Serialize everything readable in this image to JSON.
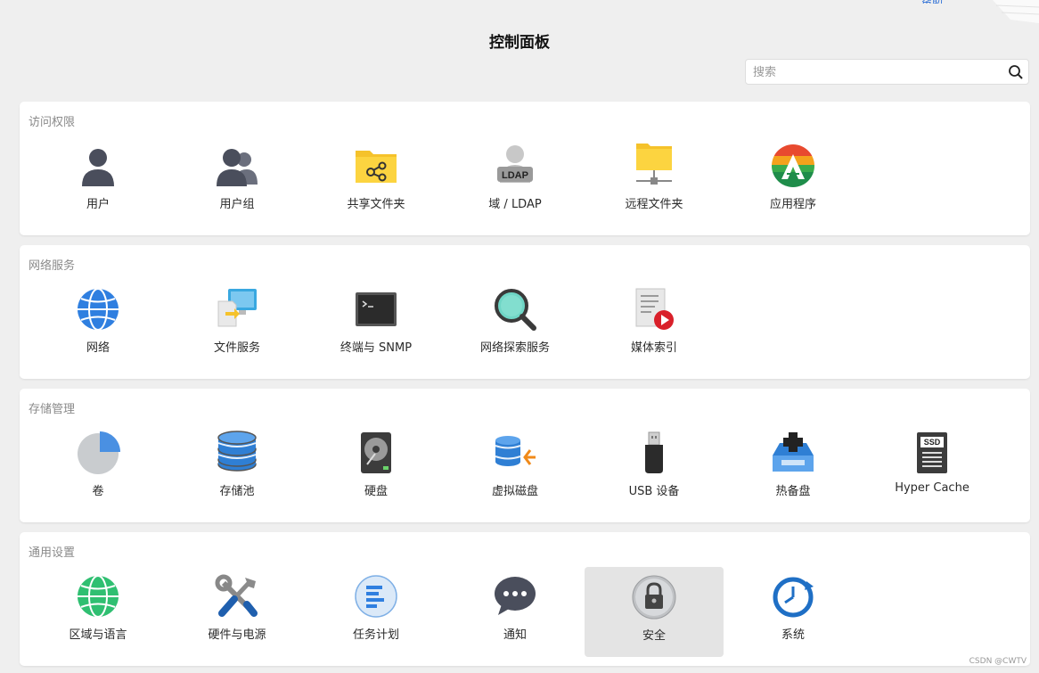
{
  "top_link": "帮助",
  "title": "控制面板",
  "search": {
    "placeholder": "搜索"
  },
  "sections": [
    {
      "title": "访问权限",
      "items": [
        {
          "label": "用户",
          "icon": "user-icon"
        },
        {
          "label": "用户组",
          "icon": "user-group-icon"
        },
        {
          "label": "共享文件夹",
          "icon": "shared-folder-icon"
        },
        {
          "label": "域 / LDAP",
          "icon": "ldap-icon"
        },
        {
          "label": "远程文件夹",
          "icon": "remote-folder-icon"
        },
        {
          "label": "应用程序",
          "icon": "application-icon"
        }
      ]
    },
    {
      "title": "网络服务",
      "items": [
        {
          "label": "网络",
          "icon": "globe-icon"
        },
        {
          "label": "文件服务",
          "icon": "file-service-icon"
        },
        {
          "label": "终端与 SNMP",
          "icon": "terminal-icon"
        },
        {
          "label": "网络探索服务",
          "icon": "magnifier-icon"
        },
        {
          "label": "媒体索引",
          "icon": "media-index-icon"
        }
      ]
    },
    {
      "title": "存储管理",
      "items": [
        {
          "label": "卷",
          "icon": "pie-volume-icon"
        },
        {
          "label": "存储池",
          "icon": "storage-pool-icon"
        },
        {
          "label": "硬盘",
          "icon": "hard-disk-icon"
        },
        {
          "label": "虚拟磁盘",
          "icon": "virtual-disk-icon"
        },
        {
          "label": "USB 设备",
          "icon": "usb-icon"
        },
        {
          "label": "热备盘",
          "icon": "hot-spare-icon"
        },
        {
          "label": "Hyper Cache",
          "icon": "ssd-icon"
        }
      ]
    },
    {
      "title": "通用设置",
      "items": [
        {
          "label": "区域与语言",
          "icon": "region-globe-icon"
        },
        {
          "label": "硬件与电源",
          "icon": "tools-icon"
        },
        {
          "label": "任务计划",
          "icon": "task-list-icon"
        },
        {
          "label": "通知",
          "icon": "chat-bubble-icon"
        },
        {
          "label": "安全",
          "icon": "lock-icon",
          "selected": true
        },
        {
          "label": "系统",
          "icon": "system-clock-icon"
        }
      ]
    }
  ],
  "watermark": "CSDN @CWTV",
  "colors": {
    "background": "#efefef",
    "selected": "#e4e4e4",
    "accent": "#2f7fe0"
  }
}
